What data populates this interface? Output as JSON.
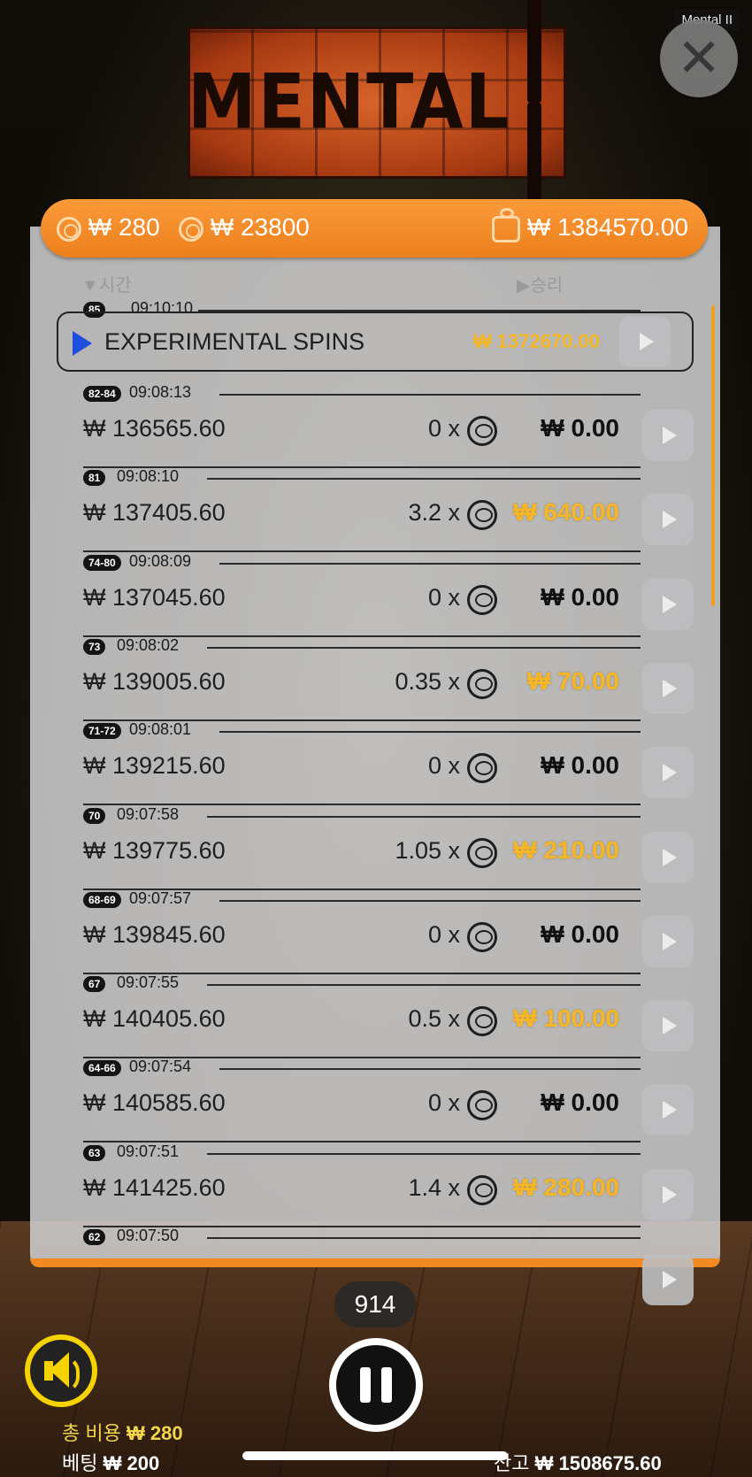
{
  "window_title": "Mental II",
  "close_glyph": "✕",
  "logo": {
    "text": "MENTAL"
  },
  "topbar": {
    "bet": "₩ 280",
    "win": "₩ 23800",
    "wallet": "₩ 1384570.00"
  },
  "headers": {
    "time": "▼시간",
    "win": "▶승리"
  },
  "experimental": {
    "badge": "85",
    "time": "09:10:10",
    "label": "EXPERIMENTAL SPINS",
    "amount": "₩ 1372670.00"
  },
  "rows": [
    {
      "badge": "82-84",
      "time": "09:08:13",
      "balance": "₩ 136565.60",
      "mult": "0 x",
      "win": "₩ 0.00",
      "gold": false
    },
    {
      "badge": "81",
      "time": "09:08:10",
      "balance": "₩ 137405.60",
      "mult": "3.2 x",
      "win": "₩ 640.00",
      "gold": true
    },
    {
      "badge": "74-80",
      "time": "09:08:09",
      "balance": "₩ 137045.60",
      "mult": "0 x",
      "win": "₩ 0.00",
      "gold": false
    },
    {
      "badge": "73",
      "time": "09:08:02",
      "balance": "₩ 139005.60",
      "mult": "0.35 x",
      "win": "₩ 70.00",
      "gold": true
    },
    {
      "badge": "71-72",
      "time": "09:08:01",
      "balance": "₩ 139215.60",
      "mult": "0 x",
      "win": "₩ 0.00",
      "gold": false
    },
    {
      "badge": "70",
      "time": "09:07:58",
      "balance": "₩ 139775.60",
      "mult": "1.05 x",
      "win": "₩ 210.00",
      "gold": true
    },
    {
      "badge": "68-69",
      "time": "09:07:57",
      "balance": "₩ 139845.60",
      "mult": "0 x",
      "win": "₩ 0.00",
      "gold": false
    },
    {
      "badge": "67",
      "time": "09:07:55",
      "balance": "₩ 140405.60",
      "mult": "0.5 x",
      "win": "₩ 100.00",
      "gold": true
    },
    {
      "badge": "64-66",
      "time": "09:07:54",
      "balance": "₩ 140585.60",
      "mult": "0 x",
      "win": "₩ 0.00",
      "gold": false
    },
    {
      "badge": "63",
      "time": "09:07:51",
      "balance": "₩ 141425.60",
      "mult": "1.4 x",
      "win": "₩ 280.00",
      "gold": true
    },
    {
      "badge": "62",
      "time": "09:07:50",
      "balance": "",
      "mult": "",
      "win": "",
      "gold": false
    }
  ],
  "counter": "914",
  "footer": {
    "total_cost_label": "총 비용",
    "total_cost": "₩ 280",
    "bet_label": "베팅",
    "bet": "₩ 200",
    "balance_label": "잔고",
    "balance": "₩ 1508675.60"
  },
  "colors": {
    "accent": "#f48c2a",
    "gold": "#f6b726",
    "sound": "#f6d200"
  }
}
